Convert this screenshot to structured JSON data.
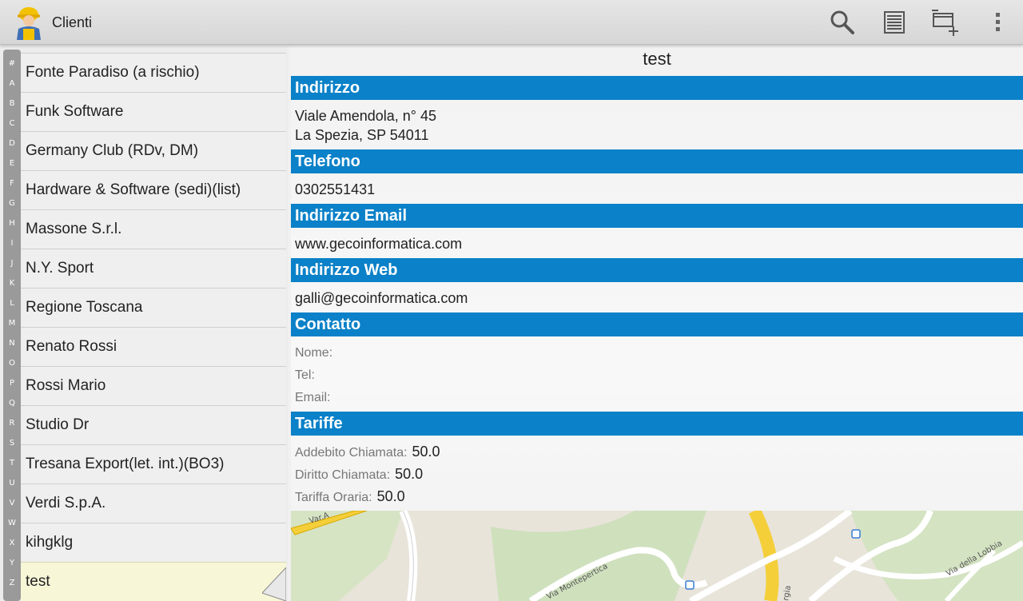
{
  "app": {
    "title": "Clienti"
  },
  "toolbar": {
    "search_icon": "search-icon",
    "list_icon": "list-icon",
    "add_icon": "add-window-icon",
    "overflow_icon": "overflow-menu-icon"
  },
  "index_letters": [
    "#",
    "A",
    "B",
    "C",
    "D",
    "E",
    "F",
    "G",
    "H",
    "I",
    "J",
    "K",
    "L",
    "M",
    "N",
    "O",
    "P",
    "Q",
    "R",
    "S",
    "T",
    "U",
    "V",
    "W",
    "X",
    "Y",
    "Z"
  ],
  "clients": [
    "Fonte Paradiso (a rischio)",
    "Funk Software",
    "Germany Club  (RDv, DM)",
    "Hardware & Software  (sedi)(list)",
    "Massone S.r.l.",
    "N.Y. Sport",
    "Regione Toscana",
    "Renato Rossi",
    "Rossi Mario",
    "Studio Dr",
    "Tresana Export(let. int.)(BO3)",
    "Verdi S.p.A.",
    "kihgklg",
    "test"
  ],
  "selected_client": "test",
  "detail": {
    "title": "test",
    "address": {
      "header": "Indirizzo",
      "line1": "Viale Amendola, n° 45",
      "line2": "La Spezia, SP 54011"
    },
    "phone": {
      "header": "Telefono",
      "value": "0302551431"
    },
    "email": {
      "header": "Indirizzo Email",
      "value": "www.gecoinformatica.com"
    },
    "web": {
      "header": "Indirizzo Web",
      "value": "galli@gecoinformatica.com"
    },
    "contact": {
      "header": "Contatto",
      "name_label": "Nome:",
      "tel_label": "Tel:",
      "email_label": "Email:"
    },
    "rates": {
      "header": "Tariffe",
      "call_charge_label": "Addebito Chiamata:",
      "call_charge_value": "50.0",
      "call_fee_label": "Diritto Chiamata:",
      "call_fee_value": "50.0",
      "hourly_label": "Tariffa Oraria:",
      "hourly_value": "50.0"
    }
  },
  "map": {
    "labels": [
      "Var.A",
      "Via Montepertica",
      "Via della Lobbia",
      "rgia"
    ]
  },
  "colors": {
    "section_header": "#0a81c8",
    "selected_row": "#f7f7d8"
  }
}
